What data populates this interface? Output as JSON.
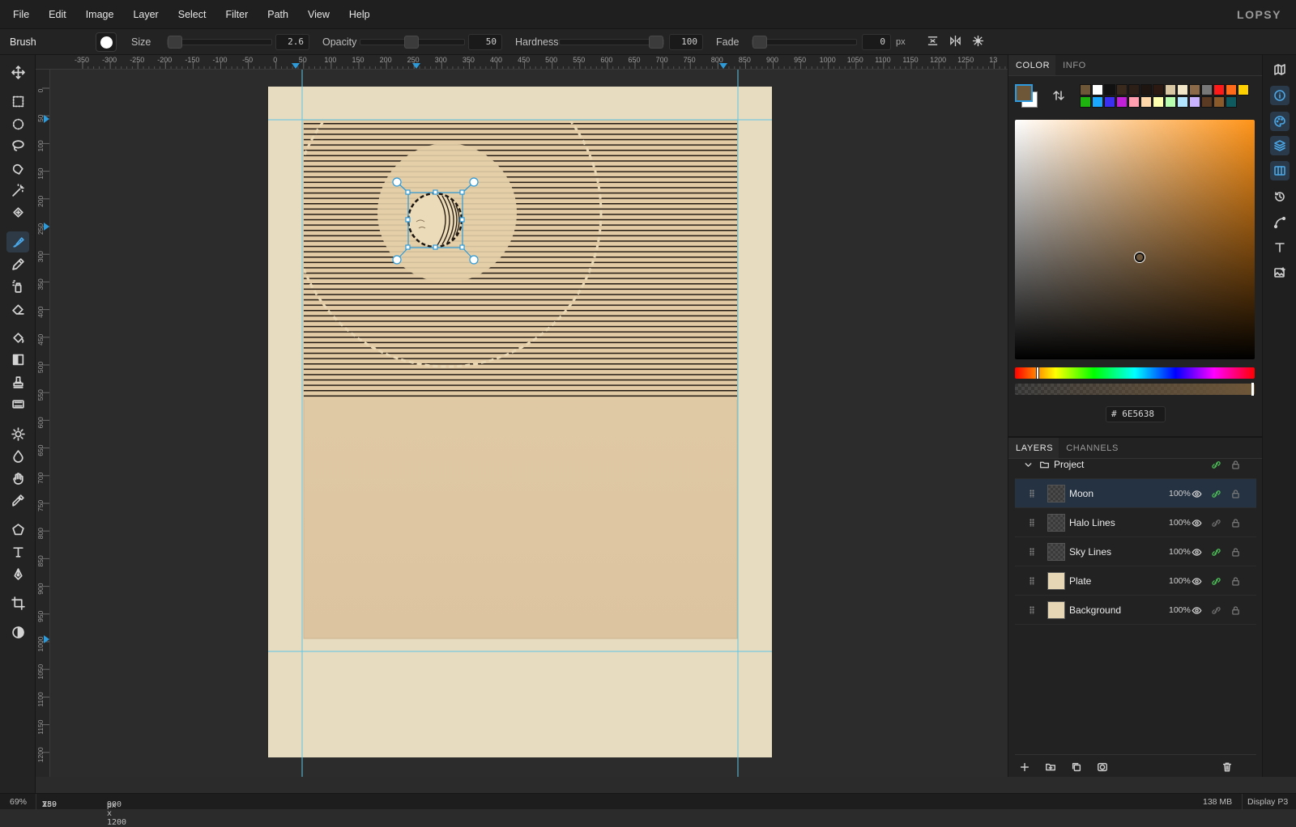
{
  "app": {
    "logo": "LOPSY"
  },
  "menu": [
    "File",
    "Edit",
    "Image",
    "Layer",
    "Select",
    "Filter",
    "Path",
    "View",
    "Help"
  ],
  "options": {
    "tool_name": "Brush",
    "size_label": "Size",
    "size_value": "2.6",
    "opacity_label": "Opacity",
    "opacity_value": "50",
    "hardness_label": "Hardness",
    "hardness_value": "100",
    "fade_label": "Fade",
    "fade_value": "0",
    "fade_unit": "px"
  },
  "tools": [
    "move-icon",
    "rect-select-icon",
    "ellipse-select-icon",
    "lasso-icon",
    "quick-select-icon",
    "magic-wand-icon",
    "heal-icon",
    "brush-icon",
    "pencil-icon",
    "spray-icon",
    "eraser-icon",
    "fill-icon",
    "gradient-icon",
    "stamp-icon",
    "pattern-icon",
    "sharpen-icon",
    "blur-icon",
    "hand-icon",
    "eyedropper-icon",
    "polygon-icon",
    "text-icon",
    "pen-icon",
    "crop-icon",
    "contrast-icon"
  ],
  "active_tool": "brush-icon",
  "ruler_top": [
    "-350",
    "-300",
    "-250",
    "-200",
    "-150",
    "-100",
    "-50",
    "0",
    "50",
    "100",
    "150",
    "200",
    "250",
    "300",
    "350",
    "400",
    "450",
    "500",
    "550",
    "600",
    "650",
    "700",
    "750",
    "800",
    "850",
    "900",
    "950",
    "1000",
    "1050",
    "1100",
    "1150",
    "1200",
    "1250",
    "13"
  ],
  "ruler_left": [
    "0",
    "50",
    "100",
    "150",
    "200",
    "250",
    "300",
    "350",
    "400",
    "450",
    "500",
    "550",
    "600",
    "650",
    "700",
    "750",
    "800",
    "850",
    "900",
    "950",
    "1000",
    "1050",
    "1100",
    "1150",
    "1200"
  ],
  "color_panel": {
    "tabs": [
      "COLOR",
      "INFO"
    ],
    "active_tab": "COLOR",
    "foreground": "#6E5638",
    "background": "#FFFFFF",
    "hex_prefix": "#",
    "hex": "6E5638",
    "swatches": [
      "#6e5638",
      "#ffffff",
      "#111111",
      "#3a2a1e",
      "#2b1f17",
      "#1e1410",
      "#2c1a12",
      "#d9c7a3",
      "#f1e6c8",
      "#8a6a48",
      "#777777",
      "#ff1a1a",
      "#ff6a1a",
      "#ffd000",
      "#1fb30f",
      "#1aa8ff",
      "#3b2ff0",
      "#c21fd8",
      "#ff9fb0",
      "#ffd7a8",
      "#ffffb0",
      "#b8ffb0",
      "#b3e4ff",
      "#c9b3ff",
      "#5a3a22",
      "#8a5a2a",
      "#0e5a5e"
    ]
  },
  "layers_panel": {
    "tabs": [
      "LAYERS",
      "CHANNELS"
    ],
    "active_tab": "LAYERS",
    "group": "Project",
    "layers": [
      {
        "name": "Moon",
        "opacity": "100%",
        "selected": true,
        "thumb": "checker",
        "linked": true
      },
      {
        "name": "Halo Lines",
        "opacity": "100%",
        "selected": false,
        "thumb": "checker",
        "linked": false
      },
      {
        "name": "Sky Lines",
        "opacity": "100%",
        "selected": false,
        "thumb": "checker",
        "linked": true
      },
      {
        "name": "Plate",
        "opacity": "100%",
        "selected": false,
        "thumb": "plate",
        "linked": true
      },
      {
        "name": "Background",
        "opacity": "100%",
        "selected": false,
        "thumb": "plate",
        "linked": false
      }
    ]
  },
  "status": {
    "zoom": "69%",
    "x_label": "X:",
    "x": "280",
    "y_label": "Y:",
    "y": "259",
    "doc_size": "900 x 1200",
    "doc_unit": "px",
    "memory": "138 MB",
    "display": "Display P3"
  }
}
